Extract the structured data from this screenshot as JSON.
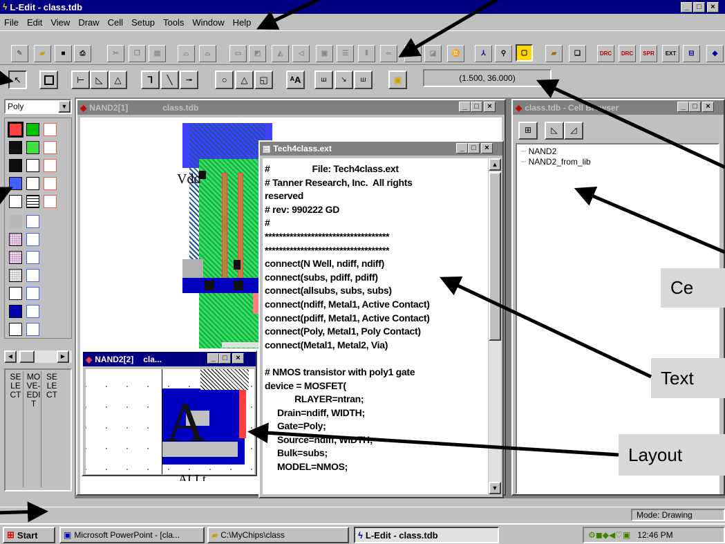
{
  "app": {
    "title": "L-Edit - class.tdb",
    "sys_buttons": [
      "_",
      "□",
      "×"
    ]
  },
  "menu": [
    "File",
    "Edit",
    "View",
    "Draw",
    "Cell",
    "Setup",
    "Tools",
    "Window",
    "Help"
  ],
  "toolbar": {
    "coordinates": "(1.500, 36.000)"
  },
  "layer_select": {
    "value": "Poly"
  },
  "mode_panels": [
    "SELECT",
    "MOVE-EDIT",
    "SELECT"
  ],
  "windows": {
    "nand2_1": {
      "title": "NAND2[1]",
      "file": "class.tdb",
      "label_vdd": "Vdd"
    },
    "nand2_2": {
      "title": "NAND2[2]",
      "file": "cla..."
    },
    "tech_ext": {
      "title": "Tech4class.ext",
      "lines": [
        "#                 File: Tech4class.ext",
        "# Tanner Research, Inc.  All rights",
        "reserved",
        "# rev: 990222 GD",
        "#",
        "***********************************",
        "***********************************",
        "connect(N Well, ndiff, ndiff)",
        "connect(subs, pdiff, pdiff)",
        "connect(allsubs, subs, subs)",
        "connect(ndiff, Metal1, Active Contact)",
        "connect(pdiff, Metal1, Active Contact)",
        "connect(Poly, Metal1, Poly Contact)",
        "connect(Metal1, Metal2, Via)",
        "",
        "# NMOS transistor with poly1 gate",
        "device = MOSFET(",
        "            RLAYER=ntran;",
        "     Drain=ndiff, WIDTH;",
        "     Gate=Poly;",
        "     Source=ndiff, WIDTH;",
        "     Bulk=subs;",
        "     MODEL=NMOS;"
      ]
    },
    "cell_browser": {
      "title": "class.tdb - Cell Browser",
      "cells": [
        "NAND2",
        "NAND2_from_lib"
      ]
    }
  },
  "status": {
    "mode": "Mode: Drawing"
  },
  "taskbar": {
    "start": "Start",
    "items": [
      "Microsoft PowerPoint - [cla...",
      "C:\\MyChips\\class",
      "L-Edit - class.tdb"
    ],
    "clock": "12:46 PM"
  },
  "callouts": [
    "Ce",
    "Text",
    "Layout"
  ],
  "colors": {
    "titlebar": "#000080",
    "face": "#c0c0c0",
    "callout_bg": "#d8d8d8"
  }
}
